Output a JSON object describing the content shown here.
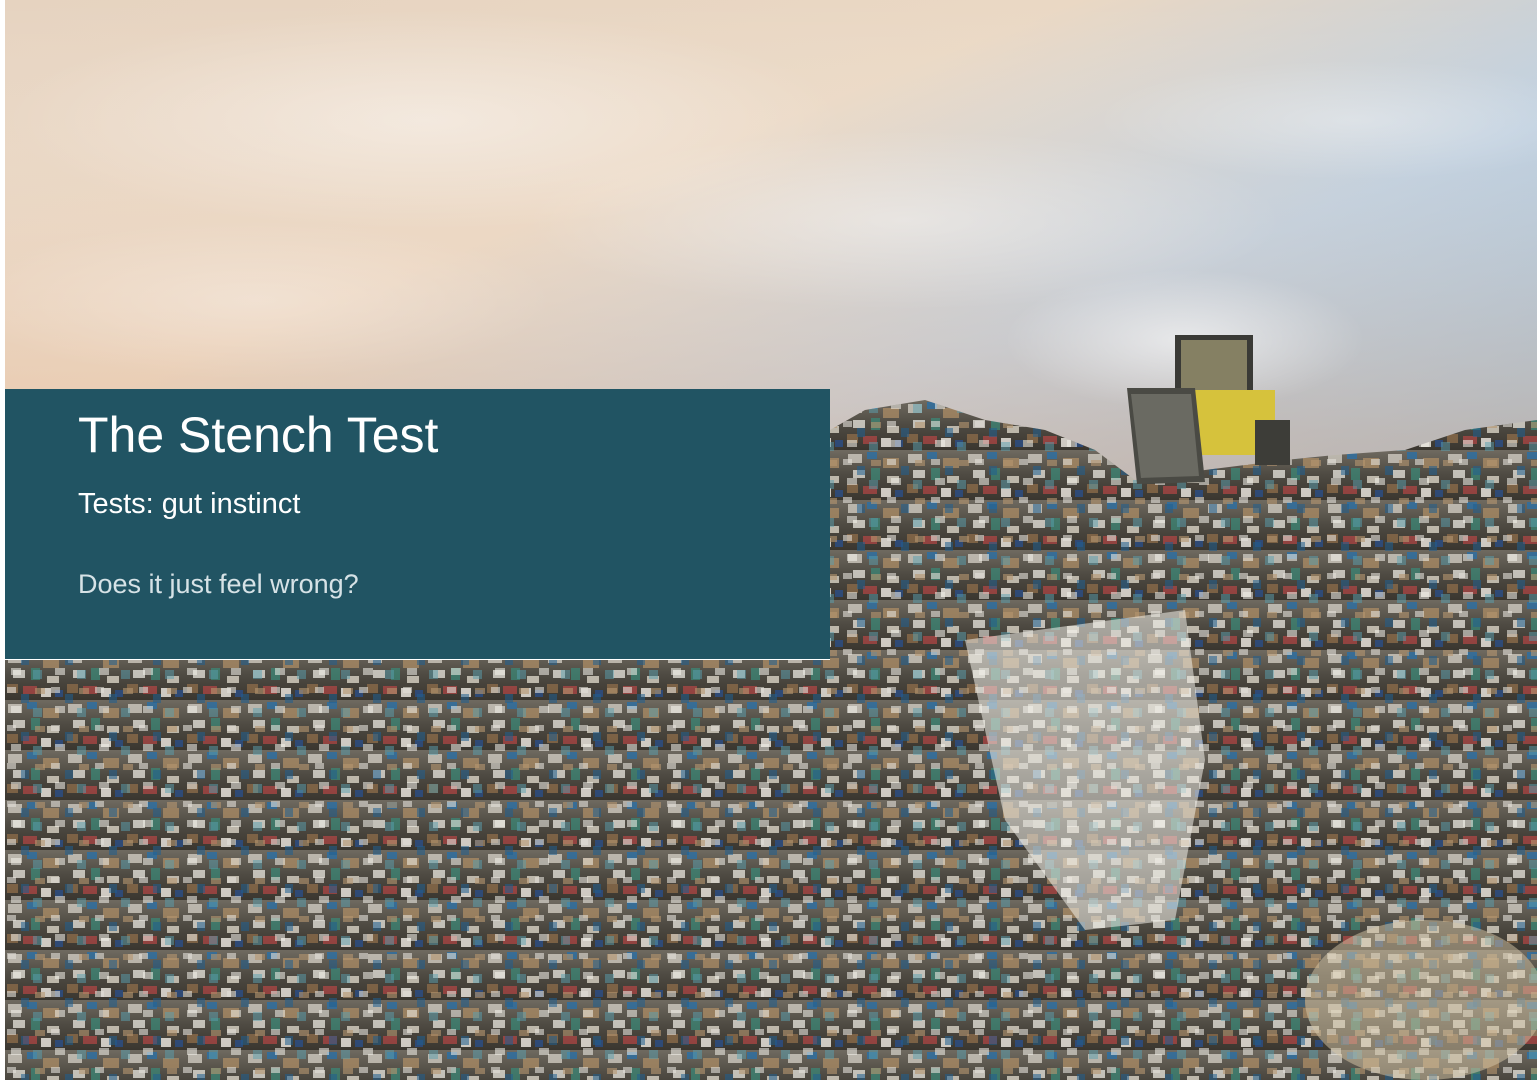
{
  "slide": {
    "title": "The Stench Test",
    "subtitle": "Tests: gut instinct",
    "body": "Does it just feel wrong?"
  },
  "background": {
    "image": "landfill-with-bulldozer-photo"
  },
  "colors": {
    "panel": "#215463",
    "title_text": "#ffffff",
    "body_text": "#d6e2e6",
    "sky_top": "#7fa6c4",
    "sky_warm": "#e8c7a6",
    "garbage_base": "#5a5448",
    "bulldozer": "#d8c23a"
  }
}
